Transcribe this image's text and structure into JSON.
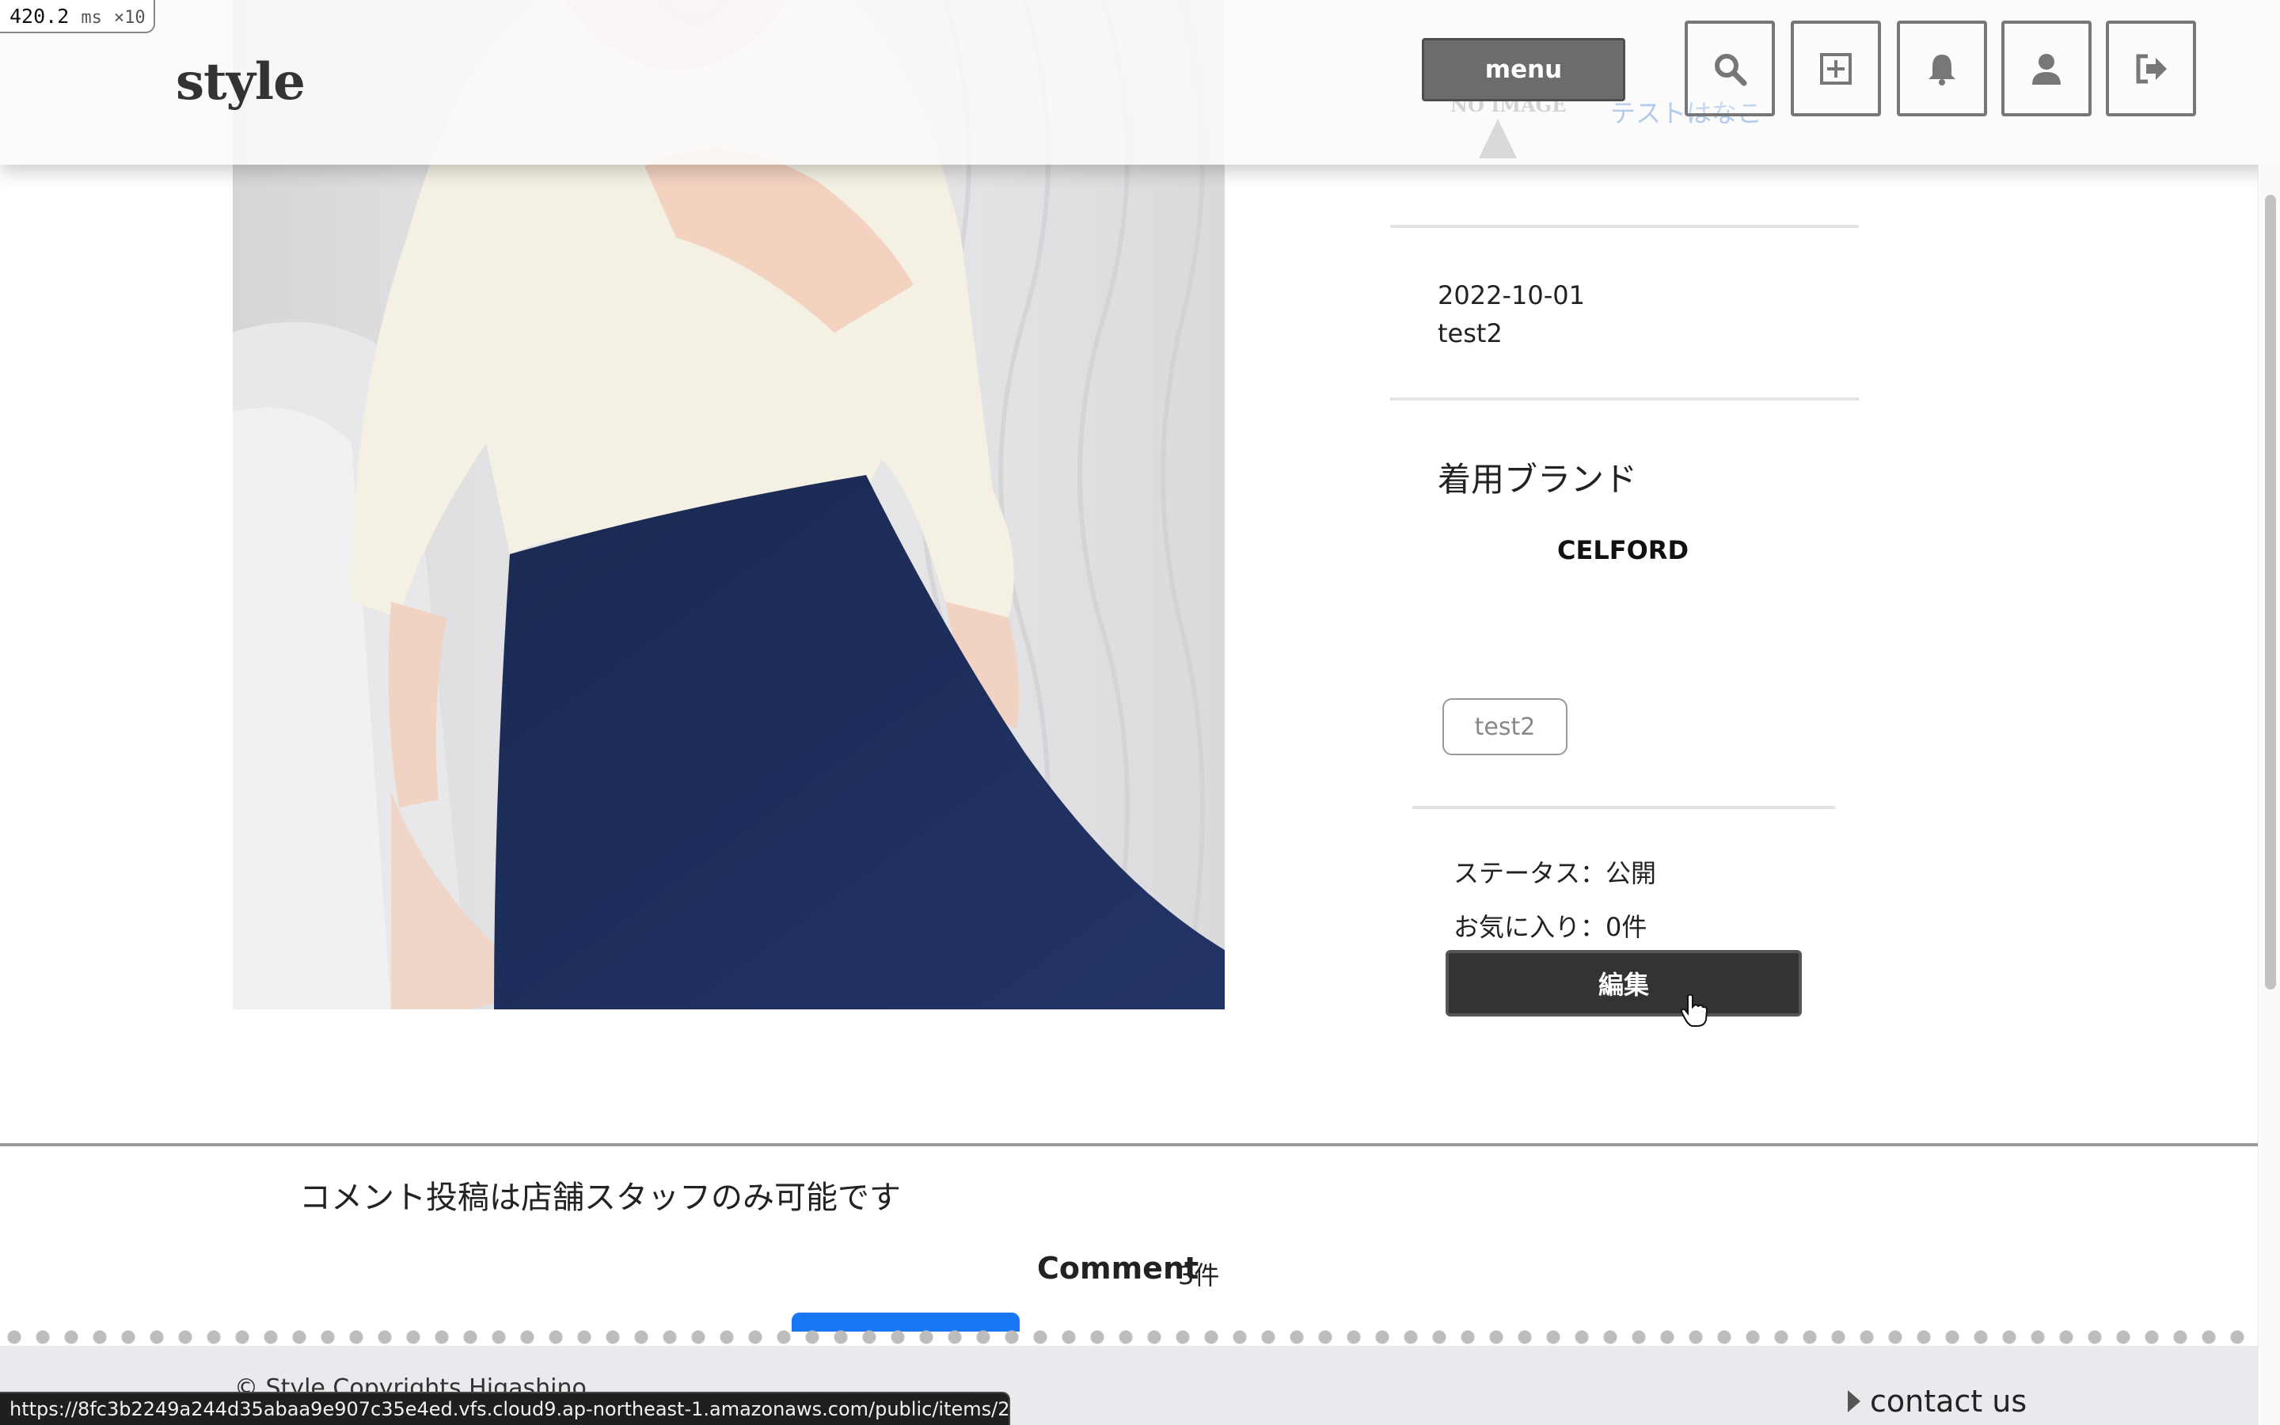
{
  "overlay": {
    "perf_value": "420.2",
    "perf_unit": "ms",
    "perf_multiplier": "×10",
    "status_url": "https://8fc3b2249a244d35abaa9e907c35e4ed.vfs.cloud9.ap-northeast-1.amazonaws.com/public/items/2/edit"
  },
  "header": {
    "logo": "style",
    "noimage_label": "NO IMAGE",
    "user_name": "テストはなこ",
    "menu_label": "menu",
    "icons": [
      "search-icon",
      "add-icon",
      "bell-icon",
      "user-icon",
      "logout-icon"
    ]
  },
  "detail": {
    "date": "2022-10-01",
    "author": "test2",
    "brand_heading": "着用ブランド",
    "brand_name": "CELFORD",
    "tag": "test2",
    "status": "ステータス：公開",
    "favorites": "お気に入り：0件",
    "edit_label": "編集"
  },
  "comments": {
    "note": "コメント投稿は店舗スタッフのみ可能です",
    "title": "Comment",
    "count": "3件"
  },
  "footer": {
    "copyright": "© Style Copyrights Higashino",
    "contact": "contact us"
  },
  "colors": {
    "accent_blue": "#1877f2",
    "button_dark": "#333333",
    "menu_gray": "#6c6c6c"
  }
}
